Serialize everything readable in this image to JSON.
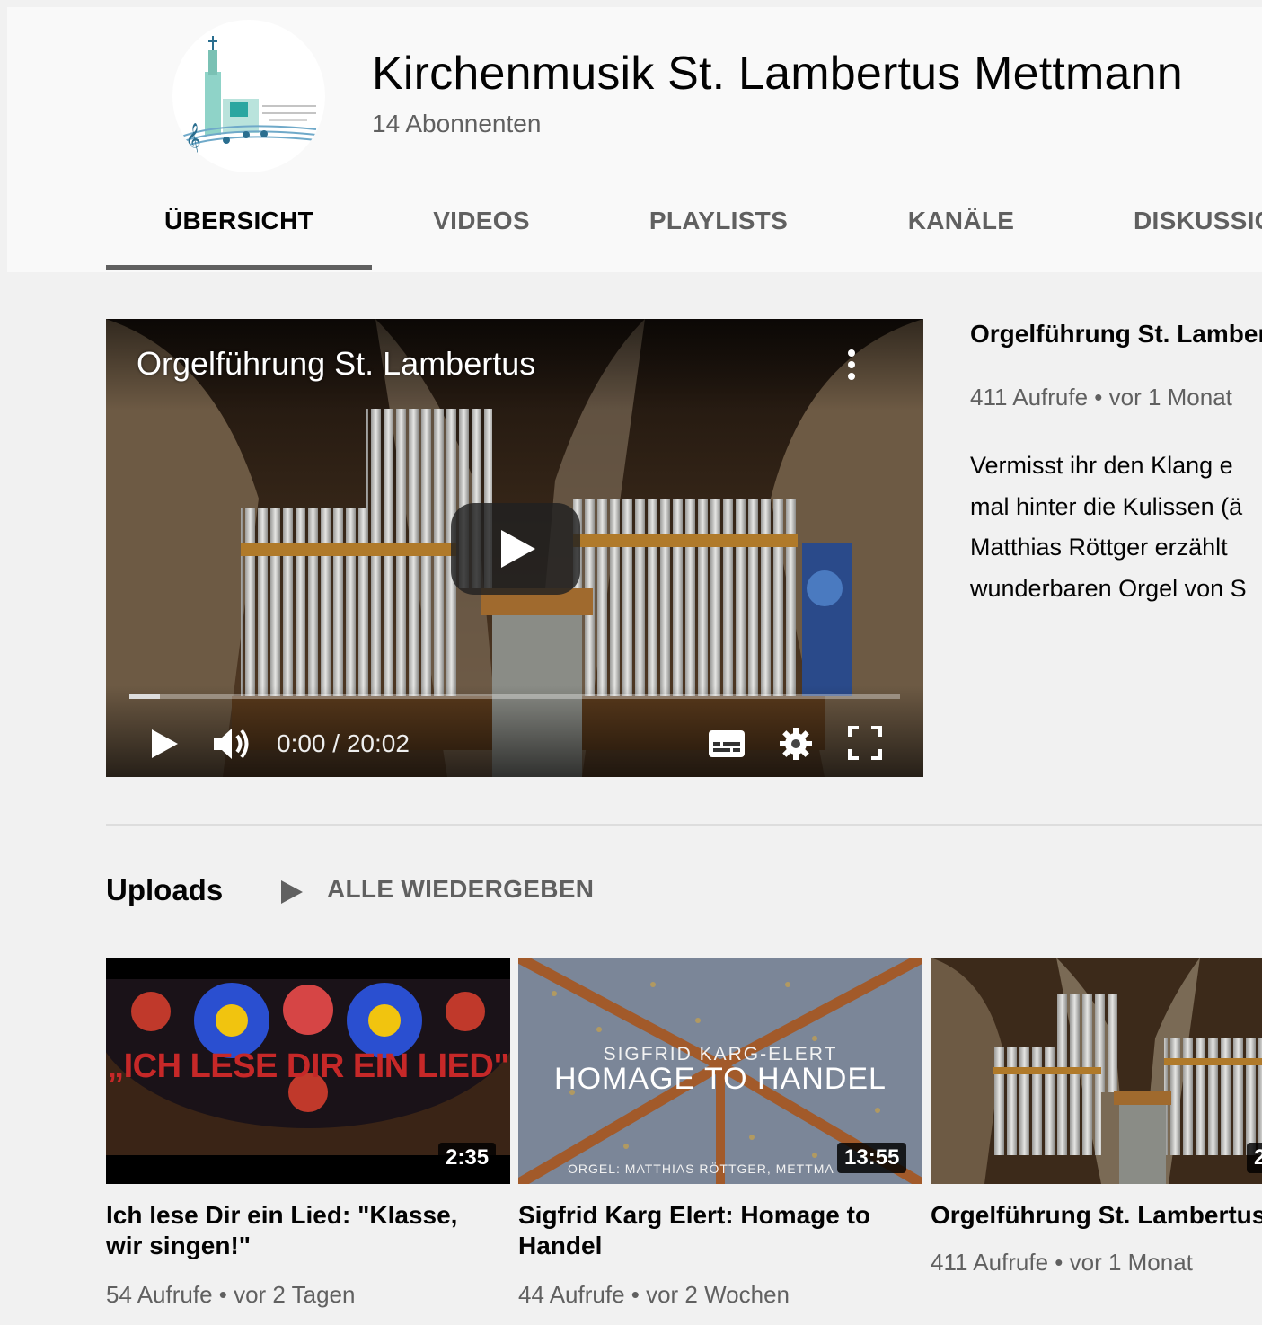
{
  "channel": {
    "name": "Kirchenmusik St. Lambertus Mettmann",
    "subscribers": "14 Abonnenten"
  },
  "tabs": [
    {
      "label": "ÜBERSICHT",
      "active": true
    },
    {
      "label": "VIDEOS",
      "active": false
    },
    {
      "label": "PLAYLISTS",
      "active": false
    },
    {
      "label": "KANÄLE",
      "active": false
    },
    {
      "label": "DISKUSSIC",
      "active": false
    }
  ],
  "player": {
    "title": "Orgelführung St. Lambertus",
    "time": "0:00 / 20:02",
    "progress": 0.04
  },
  "featured": {
    "title": "Orgelführung St. Lamber",
    "meta": "411 Aufrufe • vor 1 Monat",
    "description": [
      "Vermisst ihr den Klang e",
      "mal hinter die Kulissen (ä",
      "Matthias Röttger erzählt",
      "wunderbaren Orgel von S"
    ]
  },
  "uploads": {
    "title": "Uploads",
    "play_all": "ALLE WIEDERGEBEN",
    "videos": [
      {
        "title_lines": [
          "Ich lese Dir ein Lied: \"Klasse,",
          "wir singen!\""
        ],
        "meta": "54 Aufrufe • vor 2 Tagen",
        "duration": "2:35",
        "thumb_text": "„ICH LESE DIR EIN LIED\""
      },
      {
        "title_lines": [
          "Sigfrid Karg Elert: Homage to",
          "Handel"
        ],
        "meta": "44 Aufrufe • vor 2 Wochen",
        "duration": "13:55",
        "thumb_top": "SIGFRID KARG-ELERT",
        "thumb_main": "HOMAGE TO HANDEL",
        "thumb_bottom": "ORGEL: MATTHIAS RÖTTGER, METTMA"
      },
      {
        "title_lines": [
          "Orgelführung St. Lambertus"
        ],
        "meta": "411 Aufrufe • vor 1 Monat",
        "duration": "2"
      }
    ]
  },
  "colors": {
    "header_bg": "#f9f9f9",
    "page_bg": "#f1f1f1",
    "text_primary": "#030303",
    "text_secondary": "#606060",
    "accent_text": "#c62828"
  },
  "icons": [
    "channel-logo",
    "kebab-menu-icon",
    "big-play-icon",
    "play-icon",
    "volume-icon",
    "subtitles-icon",
    "settings-gear-icon",
    "fullscreen-icon",
    "play-all-icon"
  ]
}
